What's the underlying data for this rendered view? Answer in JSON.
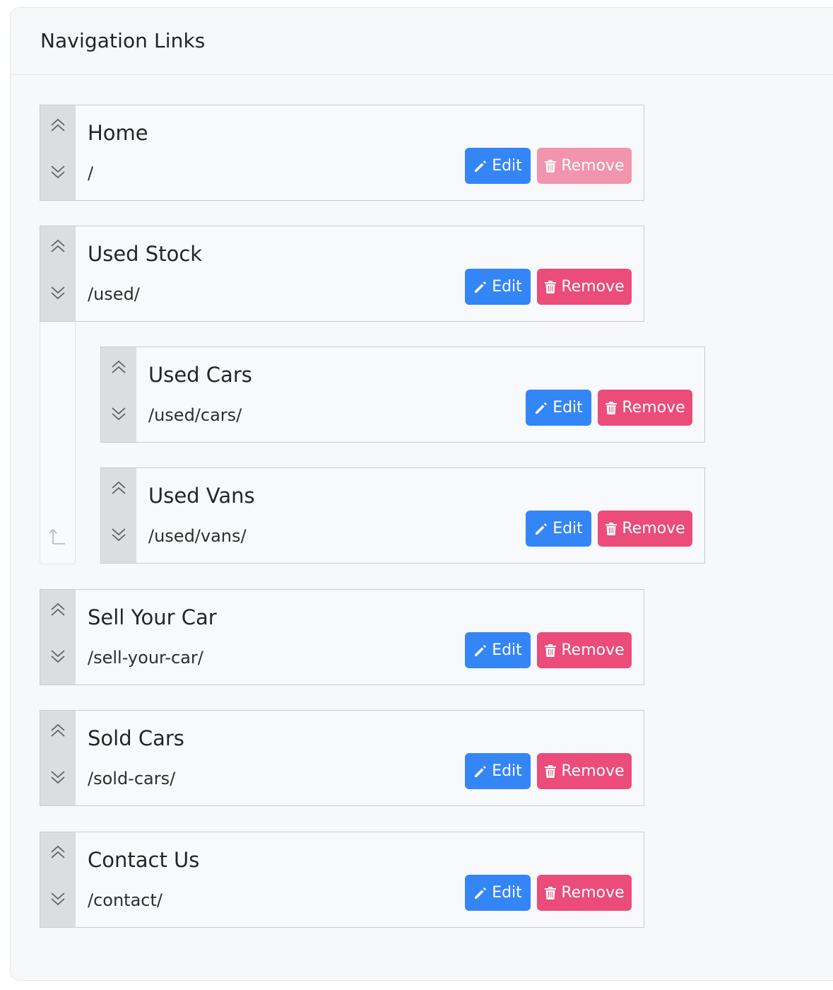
{
  "panel": {
    "title": "Navigation Links"
  },
  "buttons": {
    "edit_label": "Edit",
    "remove_label": "Remove"
  },
  "items": [
    {
      "title": "Home",
      "url": "/",
      "remove_disabled": true
    },
    {
      "title": "Used Stock",
      "url": "/used/",
      "remove_disabled": false
    },
    {
      "title": "Used Cars",
      "url": "/used/cars/",
      "remove_disabled": false,
      "parent": "Used Stock"
    },
    {
      "title": "Used Vans",
      "url": "/used/vans/",
      "remove_disabled": false,
      "parent": "Used Stock"
    },
    {
      "title": "Sell Your Car",
      "url": "/sell-your-car/",
      "remove_disabled": false
    },
    {
      "title": "Sold Cars",
      "url": "/sold-cars/",
      "remove_disabled": false
    },
    {
      "title": "Contact Us",
      "url": "/contact/",
      "remove_disabled": false
    }
  ],
  "icons": {
    "move_up": "double-chevron-up-icon",
    "move_down": "double-chevron-down-icon",
    "edit": "pencil-icon",
    "remove": "trash-icon",
    "outdent": "outdent-arrow-icon"
  },
  "colors": {
    "edit": "#3485f6",
    "remove": "#eb4c79",
    "remove_disabled": "#f294ad",
    "handle": "#dcdddf"
  }
}
